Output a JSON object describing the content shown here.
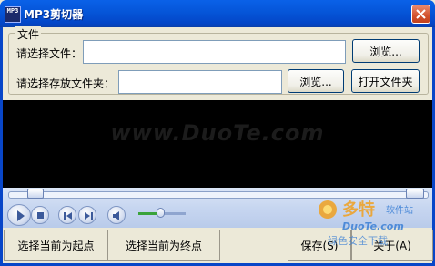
{
  "window": {
    "title": "MP3剪切器",
    "icon_text": "MP3",
    "close_icon": "close-icon"
  },
  "file_group": {
    "legend": "文件",
    "select_file_label": "请选择文件：",
    "select_file_value": "",
    "browse_label": "浏览...",
    "select_folder_label": "请选择存放文件夹：",
    "select_folder_value": "",
    "browse_folder_label": "浏览...",
    "open_folder_label": "打开文件夹"
  },
  "video": {
    "watermark": "www.DuoTe.com"
  },
  "player": {
    "volume_level": 0.4,
    "seek_position": 0.0,
    "icons": [
      "play-icon",
      "stop-icon",
      "previous-icon",
      "next-icon",
      "volume-icon"
    ]
  },
  "overlay_logo": {
    "name": "多特",
    "sub": "软件站",
    "domain": "DuoTe.com",
    "tagline": "绿色安全下载"
  },
  "bottom": {
    "set_start_label": "选择当前为起点",
    "set_end_label": "选择当前为终点",
    "save_label": "保存(S)",
    "about_label": "关于(A)"
  },
  "colors": {
    "titlebar": "#0555d8",
    "close_button": "#d2522d",
    "window_bg": "#ece9d8",
    "video_bg": "#000000",
    "logo_orange": "#f0a020",
    "logo_blue": "#3a7fd5"
  }
}
